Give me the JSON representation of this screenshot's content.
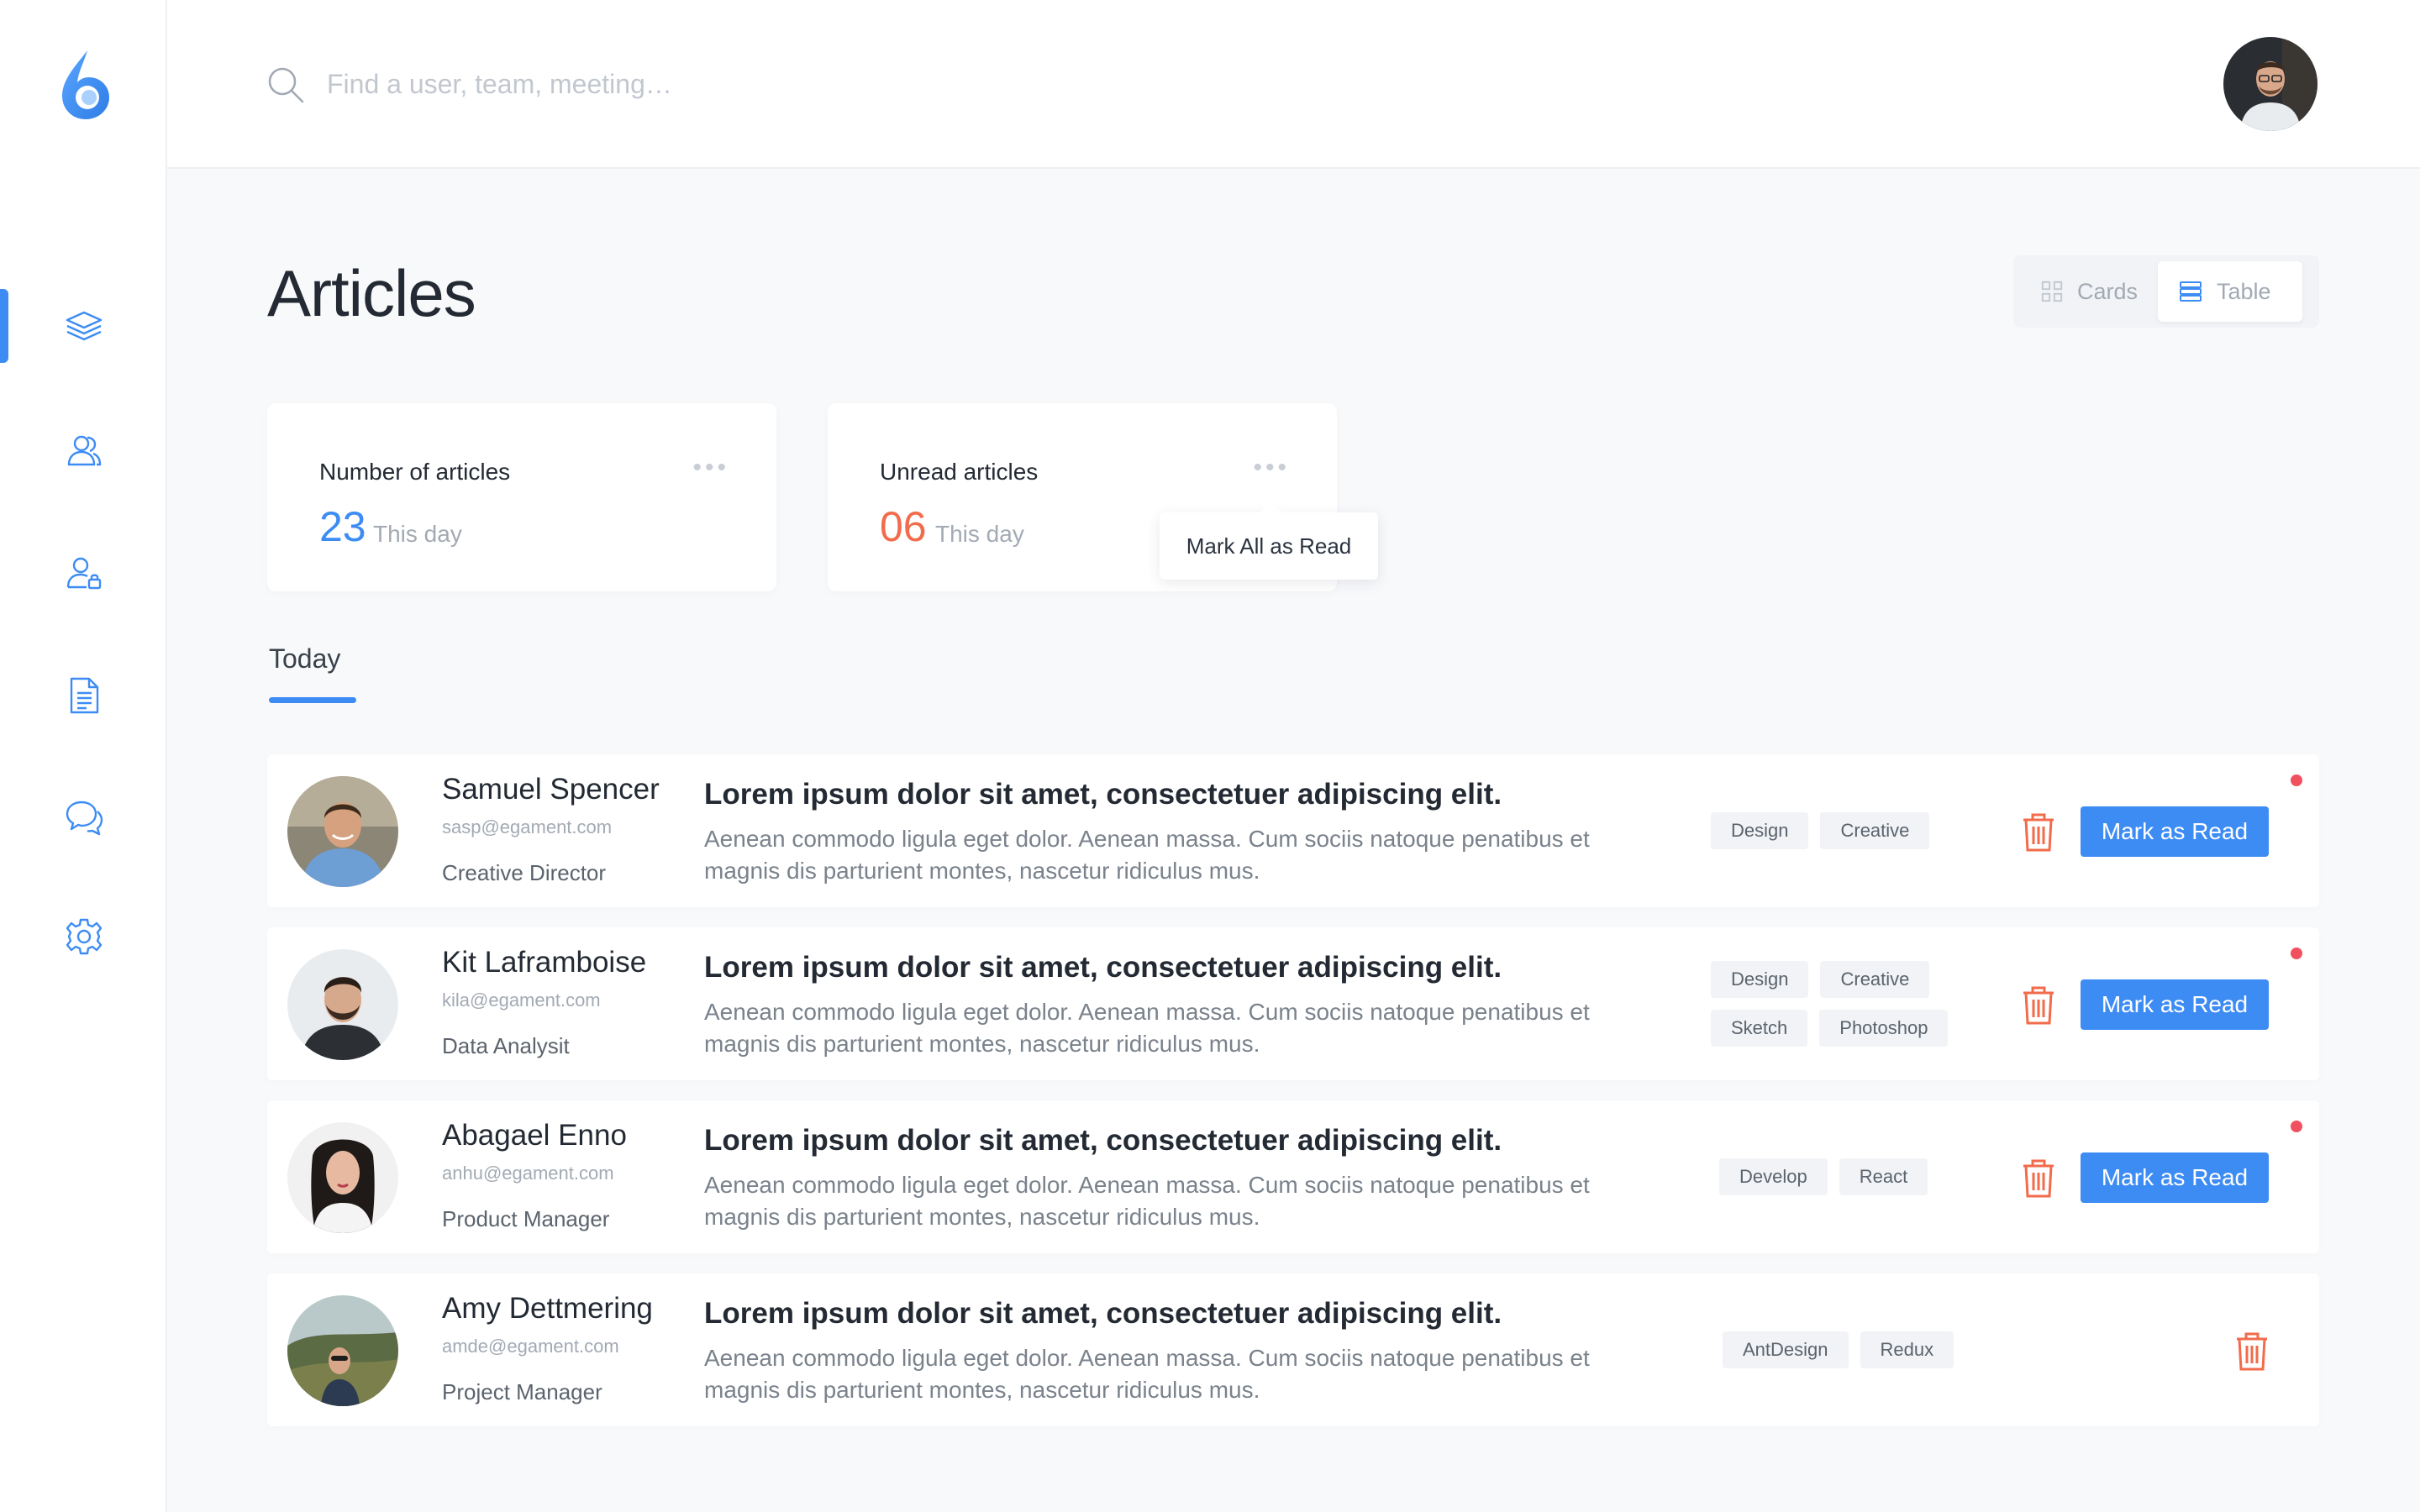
{
  "search": {
    "placeholder": "Find a user, team, meeting…"
  },
  "header": {
    "title": "Articles"
  },
  "view_toggle": {
    "cards_label": "Cards",
    "table_label": "Table",
    "selected": "Table"
  },
  "stats": [
    {
      "label": "Number of articles",
      "value": "23",
      "sub": "This day",
      "color": "#3d8cf4"
    },
    {
      "label": "Unread articles",
      "value": "06",
      "sub": "This day",
      "color": "#f26b4b"
    }
  ],
  "tooltip": {
    "label": "Mark All as Read"
  },
  "section": {
    "tab": "Today"
  },
  "colors": {
    "accent": "#3d8cf4",
    "danger": "#f26b4b",
    "unread_dot": "#f1515e"
  },
  "articles": [
    {
      "name": "Samuel Spencer",
      "email": "sasp@egament.com",
      "role": "Creative Director",
      "headline": "Lorem ipsum dolor sit amet, consectetuer adipiscing elit.",
      "body": "Aenean commodo ligula eget dolor. Aenean massa. Cum sociis natoque penatibus et magnis dis parturient montes, nascetur ridiculus mus.",
      "tags": [
        "Design",
        "Creative"
      ],
      "action": "Mark as Read",
      "unread": true
    },
    {
      "name": "Kit Laframboise",
      "email": "kila@egament.com",
      "role": "Data Analysit",
      "headline": "Lorem ipsum dolor sit amet, consectetuer adipiscing elit.",
      "body": "Aenean commodo ligula eget dolor. Aenean massa. Cum sociis natoque penatibus et magnis dis parturient montes, nascetur ridiculus mus.",
      "tags": [
        "Design",
        "Creative",
        "Sketch",
        "Photoshop"
      ],
      "action": "Mark as Read",
      "unread": true
    },
    {
      "name": "Abagael Enno",
      "email": "anhu@egament.com",
      "role": "Product Manager",
      "headline": "Lorem ipsum dolor sit amet, consectetuer adipiscing elit.",
      "body": "Aenean commodo ligula eget dolor. Aenean massa. Cum sociis natoque penatibus et magnis dis parturient montes, nascetur ridiculus mus.",
      "tags": [
        "Develop",
        "React"
      ],
      "action": "Mark as Read",
      "unread": true
    },
    {
      "name": "Amy Dettmering",
      "email": "amde@egament.com",
      "role": "Project Manager",
      "headline": "Lorem ipsum dolor sit amet, consectetuer adipiscing elit.",
      "body": "Aenean commodo ligula eget dolor. Aenean massa. Cum sociis natoque penatibus et magnis dis parturient montes, nascetur ridiculus mus.",
      "tags": [
        "AntDesign",
        "Redux"
      ],
      "action": "",
      "unread": false
    }
  ]
}
